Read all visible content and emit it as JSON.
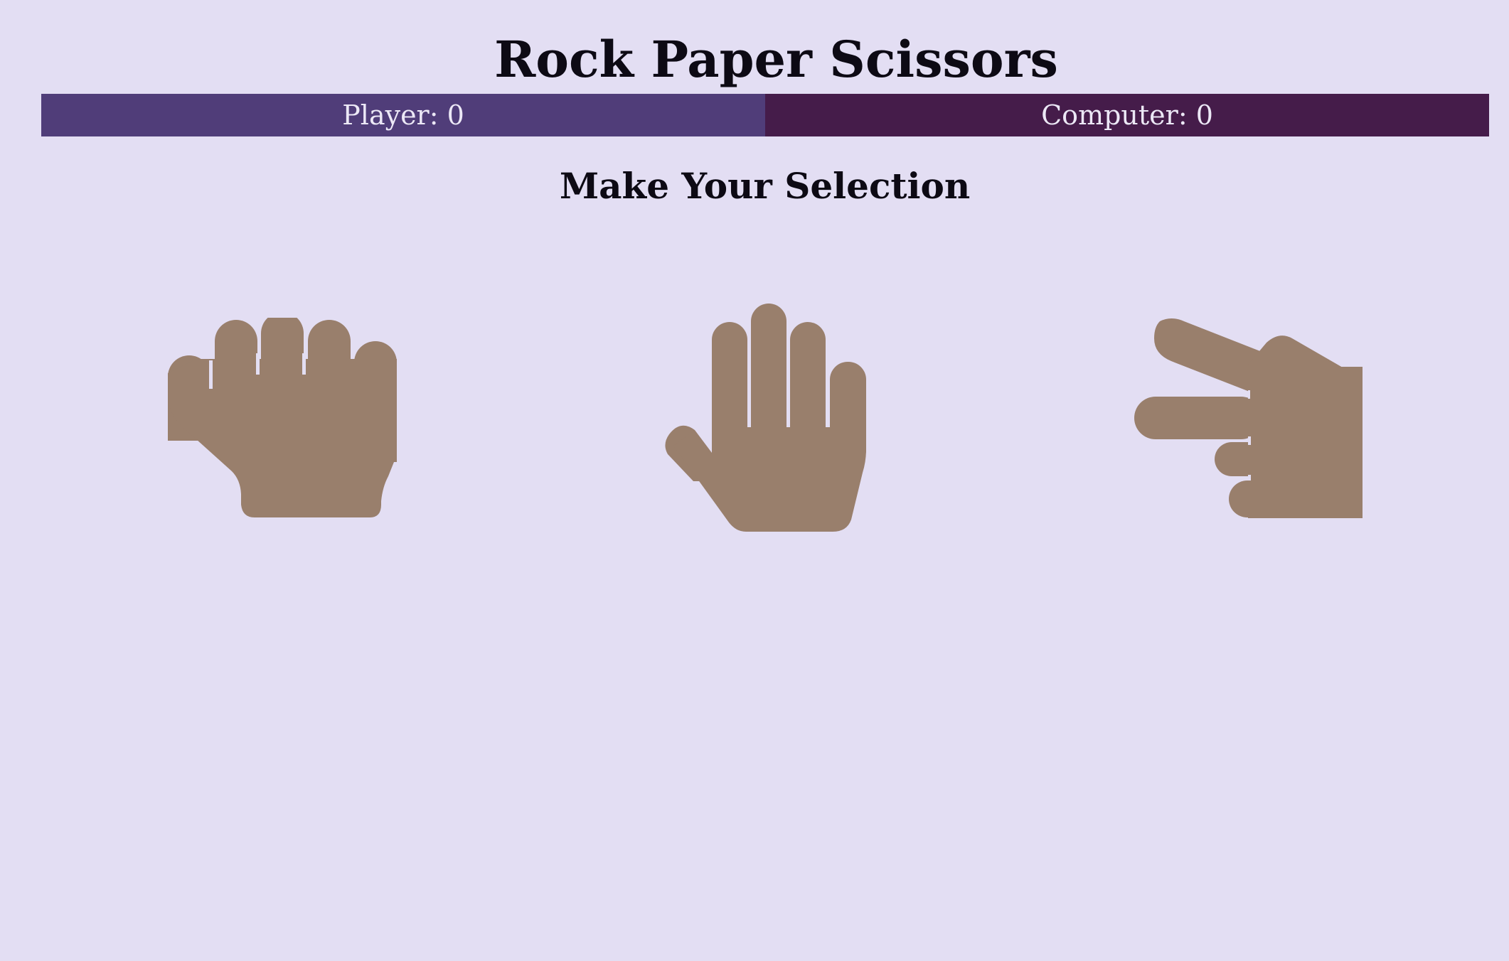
{
  "title": "Rock Paper Scissors",
  "scoreboard": {
    "player_label": "Player: 0",
    "computer_label": "Computer: 0"
  },
  "prompt": "Make Your Selection",
  "choices": [
    {
      "id": "rock",
      "icon": "hand-fist-icon"
    },
    {
      "id": "paper",
      "icon": "hand-paper-icon"
    },
    {
      "id": "scissors",
      "icon": "hand-scissors-icon"
    }
  ],
  "colors": {
    "background": "#e3def3",
    "player_bar": "#503d79",
    "computer_bar": "#451c4a",
    "hand": "#997f6c",
    "text": "#0d0a14"
  }
}
